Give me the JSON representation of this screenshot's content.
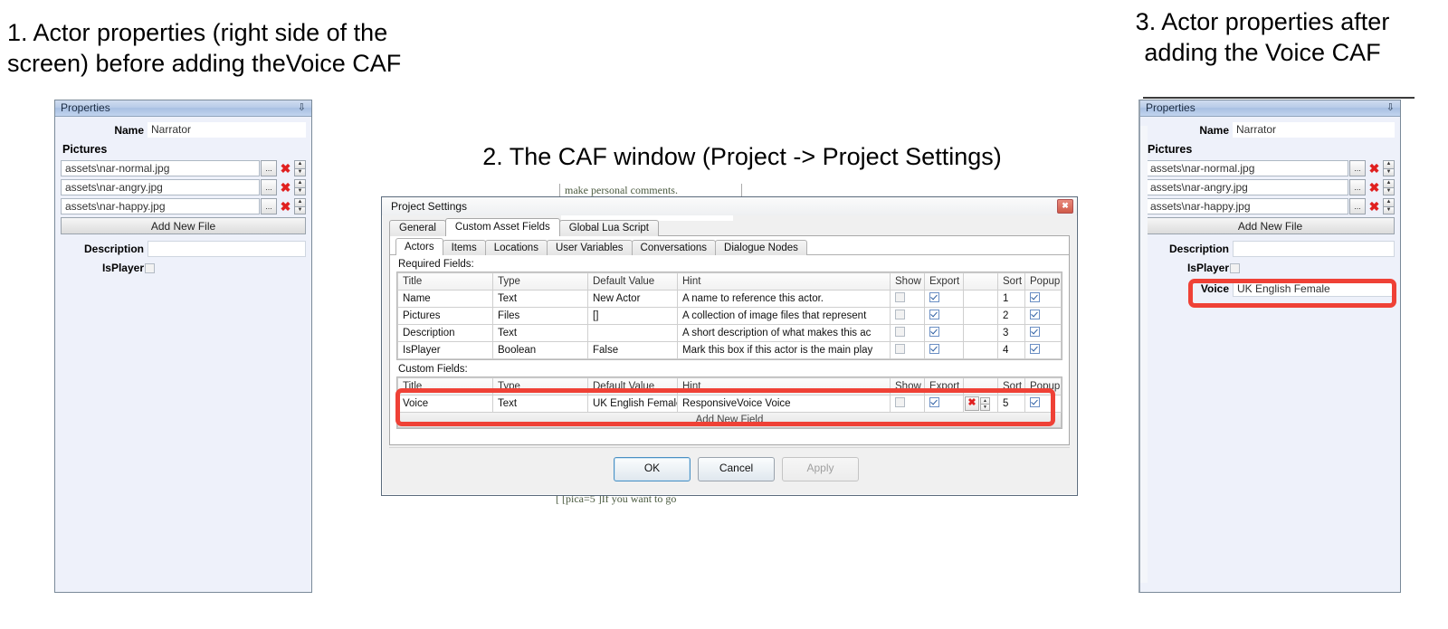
{
  "captions": {
    "one": "1. Actor properties (right side of the\n screen) before adding theVoice CAF",
    "two": "2. The CAF window (Project -> Project Settings)",
    "three": "3. Actor properties after\nadding the Voice CAF"
  },
  "properties_before": {
    "title": "Properties",
    "pin_icon": "pin-icon",
    "name_label": "Name",
    "name_value": "Narrator",
    "pictures_label": "Pictures",
    "pictures": [
      "assets\\nar-normal.jpg",
      "assets\\nar-angry.jpg",
      "assets\\nar-happy.jpg"
    ],
    "browse_label": "...",
    "delete_label": "✖",
    "add_new_file_label": "Add New File",
    "description_label": "Description",
    "description_value": "",
    "isplayer_label": "IsPlayer",
    "isplayer_checked": false
  },
  "properties_after": {
    "title": "Properties",
    "pin_icon": "pin-icon",
    "name_label": "Name",
    "name_value": "Narrator",
    "pictures_label": "Pictures",
    "pictures": [
      "assets\\nar-normal.jpg",
      "assets\\nar-angry.jpg",
      "assets\\nar-happy.jpg"
    ],
    "browse_label": "...",
    "delete_label": "✖",
    "add_new_file_label": "Add New File",
    "description_label": "Description",
    "description_value": "",
    "isplayer_label": "IsPlayer",
    "isplayer_checked": false,
    "voice_label": "Voice",
    "voice_value": "UK English Female"
  },
  "dialog": {
    "title": "Project Settings",
    "close_label": "✖",
    "top_tabs": [
      {
        "label": "General",
        "active": false
      },
      {
        "label": "Custom Asset Fields",
        "active": true
      },
      {
        "label": "Global Lua Script",
        "active": false
      }
    ],
    "sub_tabs": [
      {
        "label": "Actors",
        "active": true
      },
      {
        "label": "Items",
        "active": false
      },
      {
        "label": "Locations",
        "active": false
      },
      {
        "label": "User Variables",
        "active": false
      },
      {
        "label": "Conversations",
        "active": false
      },
      {
        "label": "Dialogue Nodes",
        "active": false
      }
    ],
    "required_label": "Required Fields:",
    "custom_label": "Custom Fields:",
    "columns": [
      "Title",
      "Type",
      "Default Value",
      "Hint",
      "Show",
      "Export",
      "",
      "Sort",
      "Popup"
    ],
    "required_rows": [
      {
        "title": "Name",
        "type": "Text",
        "default": "New Actor",
        "hint": "A name to reference this actor.",
        "show": false,
        "export": true,
        "sort": "1",
        "popup": true
      },
      {
        "title": "Pictures",
        "type": "Files",
        "default": "[]",
        "hint": "A collection of image files that represent",
        "show": false,
        "export": true,
        "sort": "2",
        "popup": true
      },
      {
        "title": "Description",
        "type": "Text",
        "default": "",
        "hint": "A short description of what makes this ac",
        "show": false,
        "export": true,
        "sort": "3",
        "popup": true
      },
      {
        "title": "IsPlayer",
        "type": "Boolean",
        "default": "False",
        "hint": "Mark this box if this actor is the main play",
        "show": false,
        "export": true,
        "sort": "4",
        "popup": true
      }
    ],
    "custom_rows": [
      {
        "title": "Voice",
        "type": "Text",
        "default": "UK English Female",
        "hint": "ResponsiveVoice Voice",
        "show": false,
        "export": true,
        "delete": "✖",
        "sort": "5",
        "popup": true
      }
    ],
    "add_new_field_label": "Add New Field",
    "buttons": {
      "ok": "OK",
      "cancel": "Cancel",
      "apply": "Apply"
    }
  },
  "background_text": {
    "line_top": "make personal comments.",
    "line_bottom": "[ [pica=5 ]If you want to go"
  },
  "colors": {
    "highlight": "#ef4136",
    "panel_bg": "#eef1fa",
    "title_bar": "#b9cce8"
  }
}
